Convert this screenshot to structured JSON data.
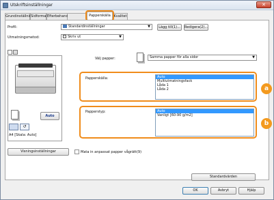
{
  "window": {
    "title": "Utskriftsinställningar",
    "close_glyph": "✕"
  },
  "tabs": [
    {
      "label": "Grundinställningar"
    },
    {
      "label": "Sidformat"
    },
    {
      "label": "Efterbehandlin"
    },
    {
      "label": "Papperskälla"
    },
    {
      "label": "Kvalitet"
    }
  ],
  "profile": {
    "label": "Profil:",
    "value": "Standardinställningar",
    "add_button": "Lägg till(1)...",
    "edit_button": "Redigera(2)..."
  },
  "output_method": {
    "label": "Utmatningsmetod:",
    "value": "Skriv ut"
  },
  "paper_select": {
    "label": "Välj papper:",
    "value": "Samma papper för alla sidor"
  },
  "paper_source": {
    "label": "Papperskälla:",
    "options": [
      "Auto",
      "Multiutmatningsfack",
      "Låda 1",
      "Låda 2"
    ],
    "selected": "Auto"
  },
  "paper_type": {
    "label": "Papperstyp:",
    "options": [
      "Auto",
      "Vanligt [60-90 g/m2]"
    ],
    "selected": "Auto"
  },
  "preview": {
    "auto_label": "Auto",
    "status_text": "A4 [Skala: Auto]"
  },
  "markers": {
    "a": "a",
    "b": "b"
  },
  "bottom": {
    "settings_button": "Visningsinställningar",
    "checkbox_label": "Mata in anpassat papper vågrätt(9)",
    "defaults_button": "Standardvärden",
    "ok_button": "OK",
    "cancel_button": "Avbryt",
    "help_button": "Hjälp"
  },
  "colors": {
    "highlight": "#f08c1a",
    "selection": "#3399ff"
  }
}
